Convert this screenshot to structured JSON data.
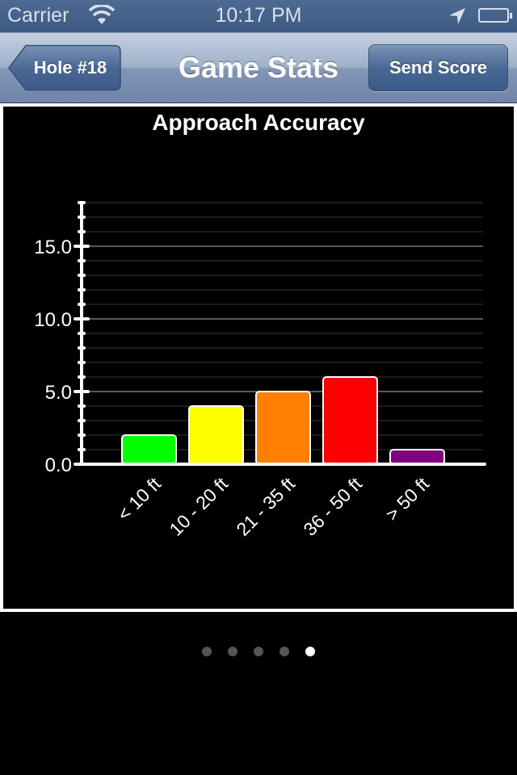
{
  "status_bar": {
    "carrier": "Carrier",
    "time": "10:17 PM",
    "icons": [
      "wifi-icon",
      "location-arrow-icon",
      "battery-icon"
    ]
  },
  "nav_bar": {
    "back_label": "Hole #18",
    "title": "Game Stats",
    "right_button_label": "Send Score"
  },
  "pager": {
    "count": 5,
    "active_index": 4
  },
  "chart_data": {
    "type": "bar",
    "title": "Approach Accuracy",
    "categories": [
      "< 10 ft",
      "10 - 20 ft",
      "21 - 35 ft",
      "36 - 50 ft",
      "> 50 ft"
    ],
    "values": [
      2,
      4,
      5,
      6,
      1
    ],
    "colors": [
      "#00ff00",
      "#ffff00",
      "#ff8000",
      "#ff0000",
      "#800080"
    ],
    "xlabel": "",
    "ylabel": "",
    "ylim": [
      0,
      18
    ],
    "yticks": [
      0,
      5,
      10,
      15
    ],
    "ytick_labels": [
      "0.0",
      "5.0",
      "10.0",
      "15.0"
    ],
    "minor_tick_step": 1,
    "grid": true,
    "background": "#000000"
  }
}
